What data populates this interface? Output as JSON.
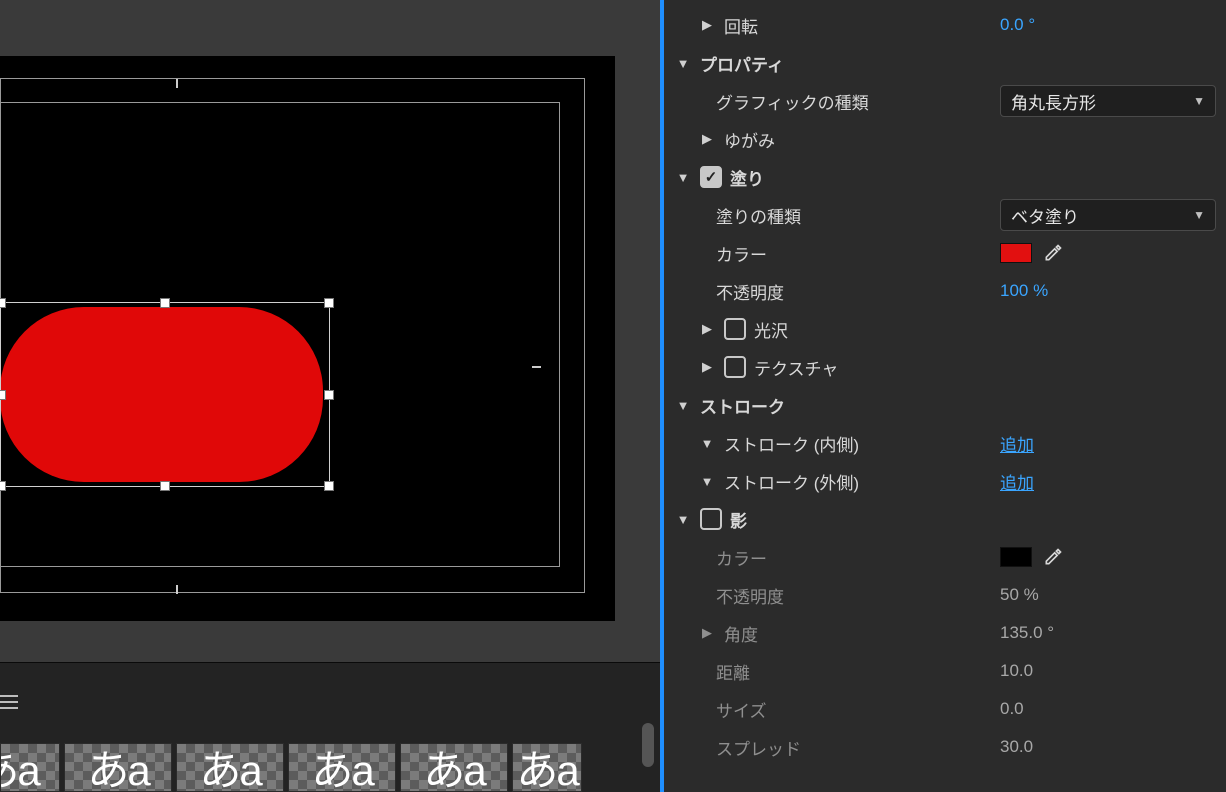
{
  "canvas": {
    "shape_type": "rounded-rectangle",
    "fill_color": "#e00808"
  },
  "thumbs": {
    "glyph": "あa"
  },
  "panel": {
    "rotation": {
      "label": "回転",
      "value": "0.0 °"
    },
    "properties": {
      "header": "プロパティ",
      "graphicType": {
        "label": "グラフィックの種類",
        "value": "角丸長方形"
      },
      "distortion": {
        "label": "ゆがみ"
      }
    },
    "fill": {
      "header": "塗り",
      "fillType": {
        "label": "塗りの種類",
        "value": "ベタ塗り"
      },
      "color": {
        "label": "カラー",
        "swatch": "#e21010"
      },
      "opacity": {
        "label": "不透明度",
        "value": "100 %"
      },
      "gloss": {
        "label": "光沢"
      },
      "texture": {
        "label": "テクスチャ"
      }
    },
    "stroke": {
      "header": "ストローク",
      "inner": {
        "label": "ストローク (内側)",
        "action": "追加"
      },
      "outer": {
        "label": "ストローク (外側)",
        "action": "追加"
      }
    },
    "shadow": {
      "header": "影",
      "color": {
        "label": "カラー",
        "swatch": "#000000"
      },
      "opacity": {
        "label": "不透明度",
        "value": "50 %"
      },
      "angle": {
        "label": "角度",
        "value": "135.0 °"
      },
      "distance": {
        "label": "距離",
        "value": "10.0"
      },
      "size": {
        "label": "サイズ",
        "value": "0.0"
      },
      "spread": {
        "label": "スプレッド",
        "value": "30.0"
      }
    }
  }
}
